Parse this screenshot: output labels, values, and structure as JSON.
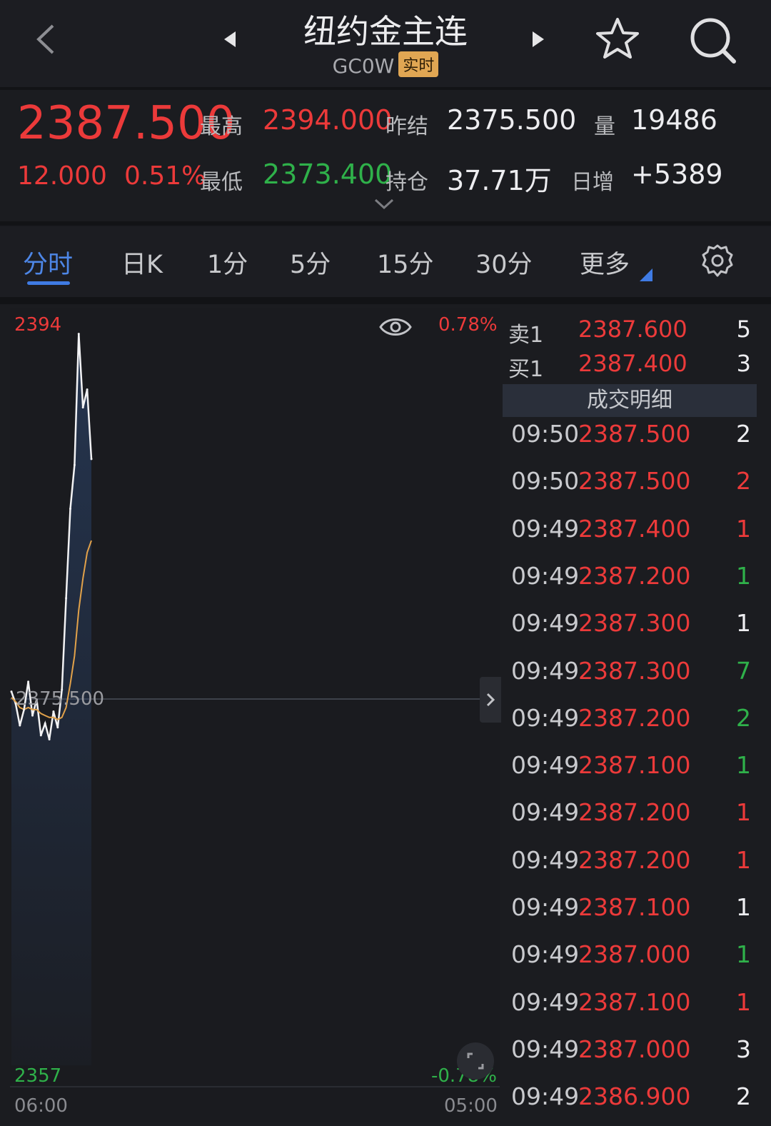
{
  "header": {
    "title": "纽约金主连",
    "symbol": "GC0W",
    "badge": "实时"
  },
  "quote": {
    "price": "2387.500",
    "change": "12.000",
    "change_pct": "0.51%",
    "high_label": "最高",
    "high": "2394.000",
    "low_label": "最低",
    "low": "2373.400",
    "prev_settle_label": "昨结",
    "prev_settle": "2375.500",
    "volume_label": "量",
    "volume": "19486",
    "open_interest_label": "持仓",
    "open_interest": "37.71万",
    "daily_change_label": "日增",
    "daily_change": "+5389"
  },
  "tabs": [
    "分时",
    "日K",
    "1分",
    "5分",
    "15分",
    "30分",
    "更多"
  ],
  "chart": {
    "top_price": "2394",
    "bottom_price": "2357",
    "top_pct": "0.78%",
    "bottom_pct": "-0.78%",
    "mid_price": "2375.500",
    "start_time": "06:00",
    "end_time": "05:00"
  },
  "chart_data": {
    "type": "line",
    "title": "",
    "xlabel": "",
    "ylabel": "",
    "ylim": [
      2357,
      2394
    ],
    "x_range": [
      "06:00",
      "05:00"
    ],
    "series": [
      {
        "values": [
          2375.8,
          2375.2,
          2374.1,
          2374.9,
          2376.3,
          2374.6,
          2375.4,
          2373.6,
          2374.2,
          2373.4,
          2374.8,
          2374.0,
          2375.9,
          2380.5,
          2385.0,
          2387.2,
          2393.8,
          2390.1,
          2391.0,
          2387.5
        ]
      },
      {
        "values": [
          2375.5,
          2375.3,
          2375.0,
          2374.9,
          2375.0,
          2374.9,
          2374.9,
          2374.7,
          2374.6,
          2374.5,
          2374.5,
          2374.4,
          2374.5,
          2375.0,
          2376.2,
          2377.6,
          2379.9,
          2381.5,
          2382.8,
          2383.4
        ]
      }
    ]
  },
  "order_book": {
    "ask_label": "卖1",
    "ask_price": "2387.600",
    "ask_volume": "5",
    "bid_label": "买1",
    "bid_price": "2387.400",
    "bid_volume": "3"
  },
  "trade_detail_header": "成交明细",
  "trades": [
    {
      "time": "09:50",
      "price": "2387.500",
      "volume": "2",
      "dir": "neutral"
    },
    {
      "time": "09:50",
      "price": "2387.500",
      "volume": "2",
      "dir": "up"
    },
    {
      "time": "09:49",
      "price": "2387.400",
      "volume": "1",
      "dir": "up"
    },
    {
      "time": "09:49",
      "price": "2387.200",
      "volume": "1",
      "dir": "down"
    },
    {
      "time": "09:49",
      "price": "2387.300",
      "volume": "1",
      "dir": "neutral"
    },
    {
      "time": "09:49",
      "price": "2387.300",
      "volume": "7",
      "dir": "down"
    },
    {
      "time": "09:49",
      "price": "2387.200",
      "volume": "2",
      "dir": "down"
    },
    {
      "time": "09:49",
      "price": "2387.100",
      "volume": "1",
      "dir": "down"
    },
    {
      "time": "09:49",
      "price": "2387.200",
      "volume": "1",
      "dir": "up"
    },
    {
      "time": "09:49",
      "price": "2387.200",
      "volume": "1",
      "dir": "up"
    },
    {
      "time": "09:49",
      "price": "2387.100",
      "volume": "1",
      "dir": "neutral"
    },
    {
      "time": "09:49",
      "price": "2387.000",
      "volume": "1",
      "dir": "down"
    },
    {
      "time": "09:49",
      "price": "2387.100",
      "volume": "1",
      "dir": "up"
    },
    {
      "time": "09:49",
      "price": "2387.000",
      "volume": "3",
      "dir": "neutral"
    },
    {
      "time": "09:49",
      "price": "2386.900",
      "volume": "2",
      "dir": "neutral"
    }
  ],
  "colors": {
    "up": "#ec3a3a",
    "down": "#2fb14a",
    "neutral": "#ededf0",
    "accent": "#3f7be4"
  }
}
